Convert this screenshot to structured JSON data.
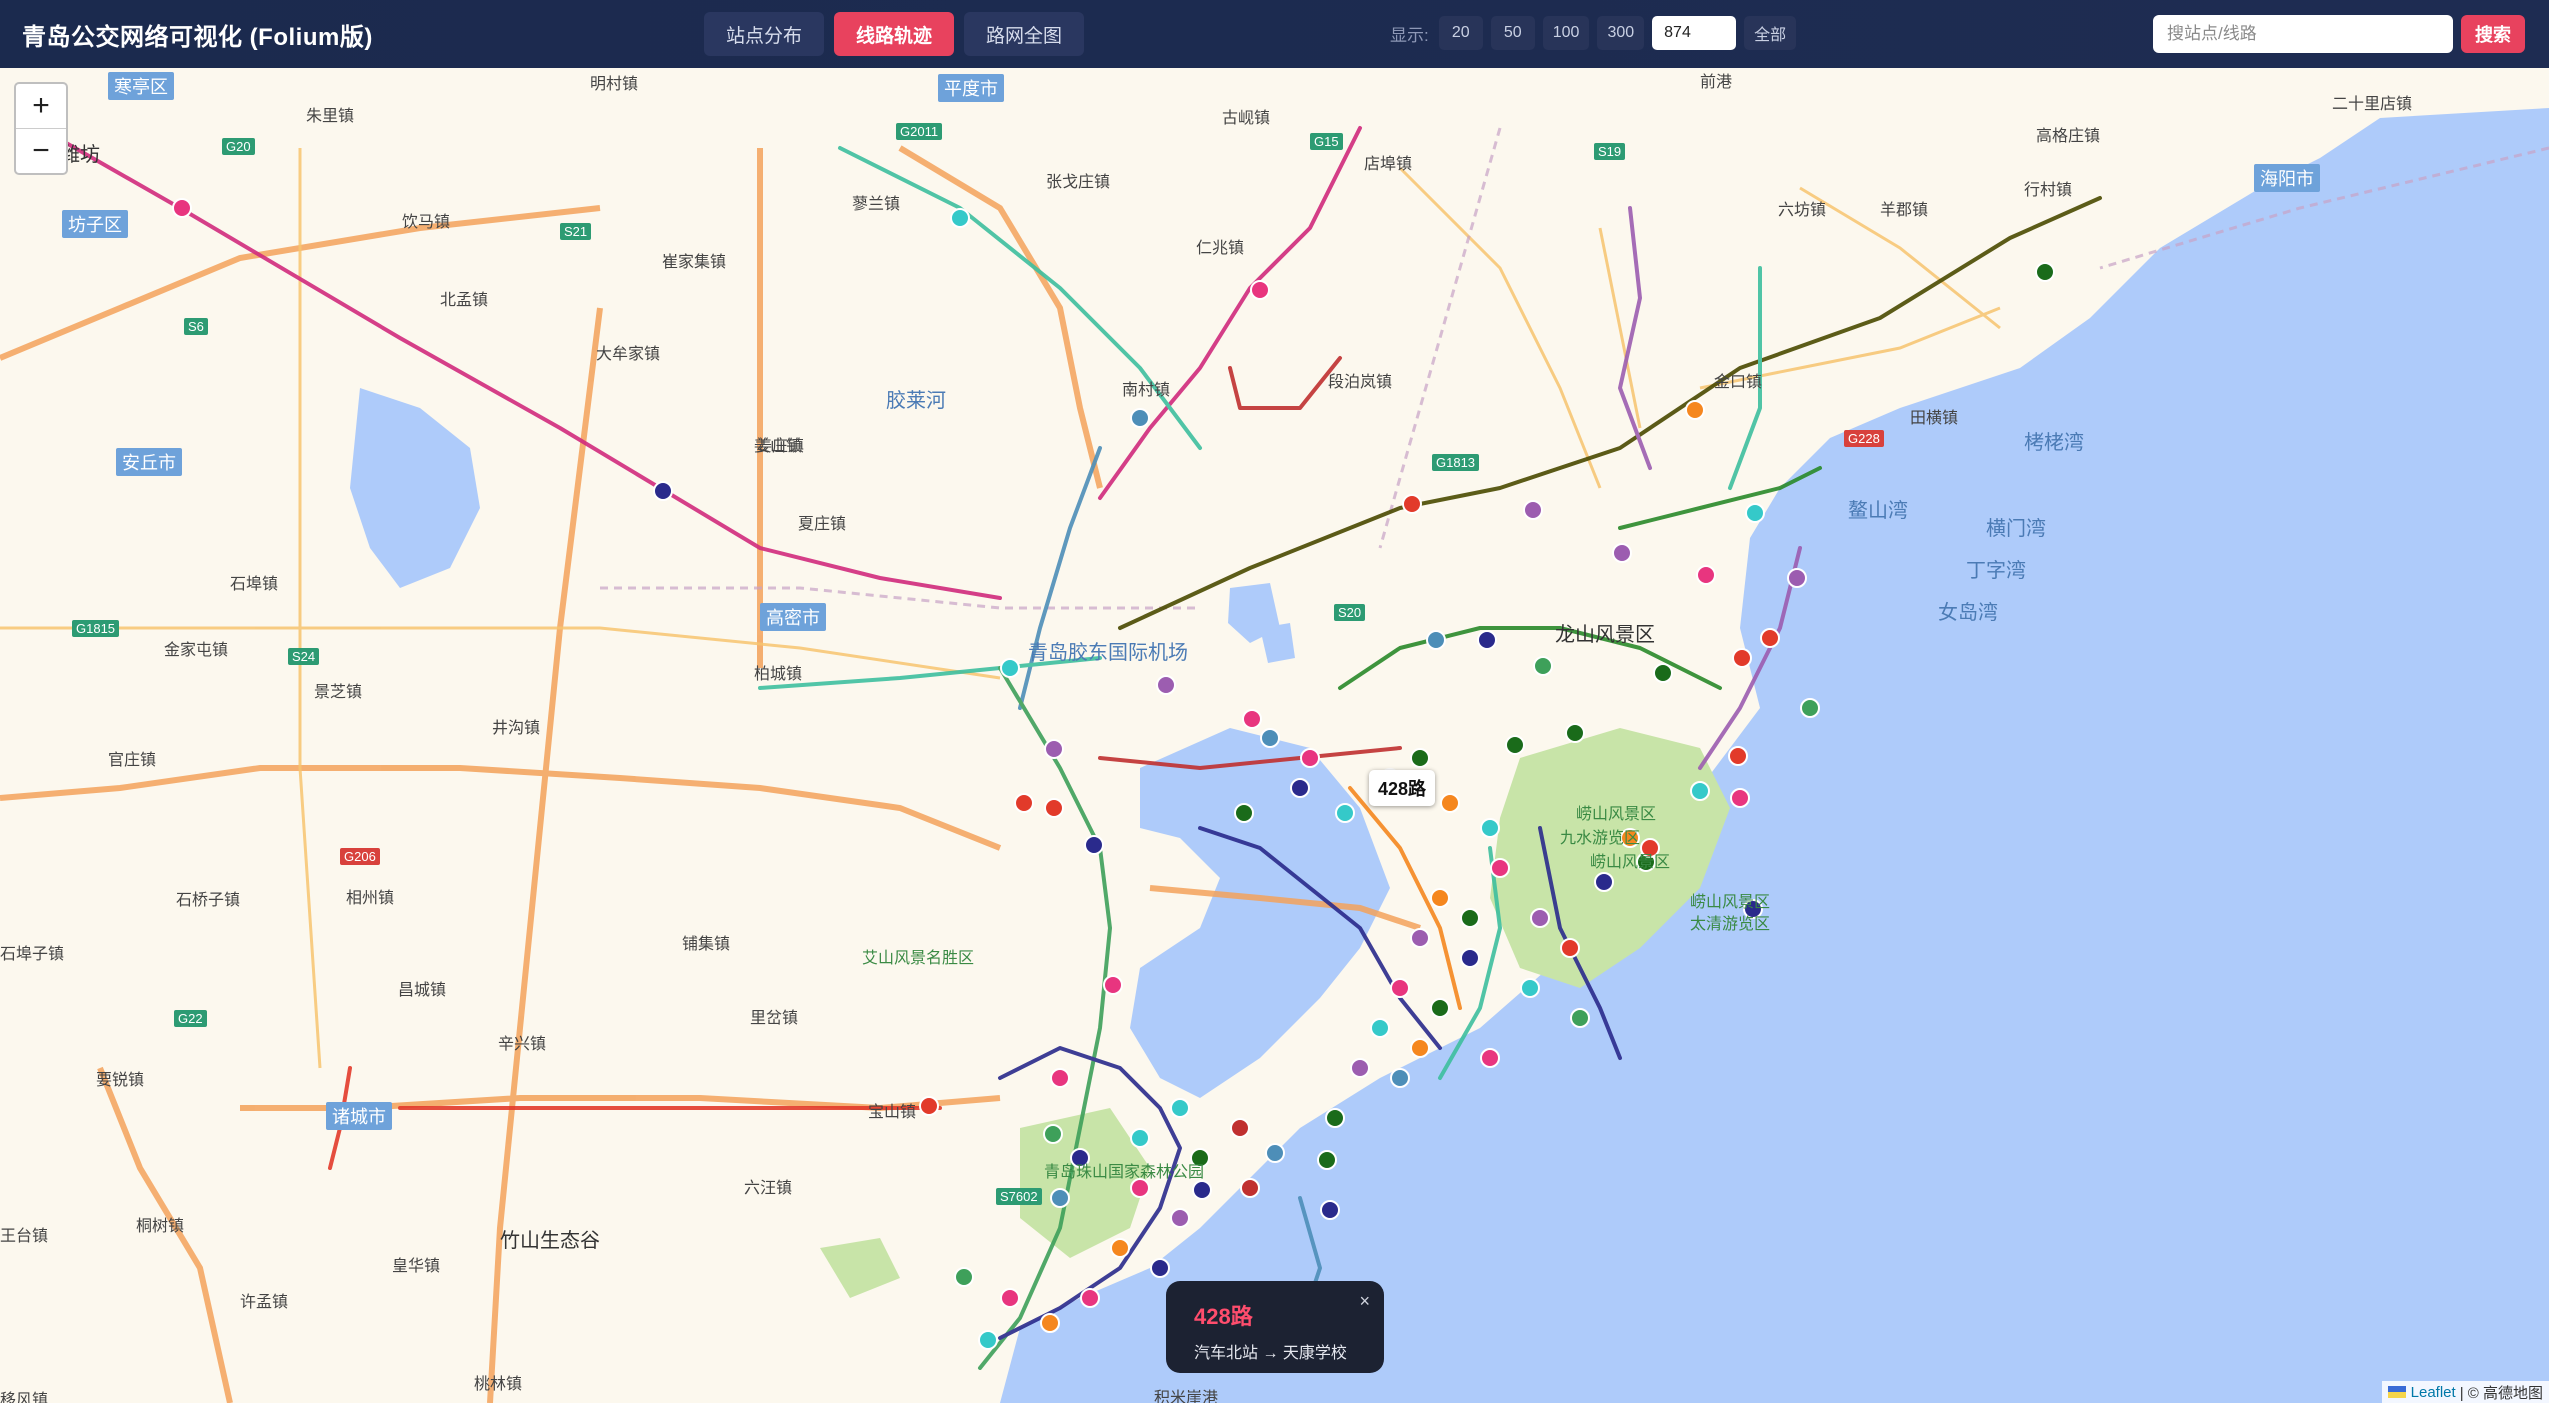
{
  "app": {
    "title": "青岛公交网络可视化 (Folium版)"
  },
  "modes": [
    {
      "label": "站点分布",
      "active": false
    },
    {
      "label": "线路轨迹",
      "active": true
    },
    {
      "label": "路网全图",
      "active": false
    }
  ],
  "display": {
    "label": "显示:",
    "options": [
      "20",
      "50",
      "100",
      "300"
    ],
    "custom_value": "874",
    "all_label": "全部"
  },
  "search": {
    "placeholder": "搜站点/线路",
    "button_label": "搜索"
  },
  "map": {
    "zoom_in": "+",
    "zoom_out": "−",
    "route_tag": "428路",
    "attribution_leaflet": "Leaflet",
    "attribution_rest": "| © 高德地图",
    "places": [
      {
        "text": "寒亭区",
        "type": "city"
      },
      {
        "text": "坊子区",
        "type": "city"
      },
      {
        "text": "安丘市",
        "type": "city"
      },
      {
        "text": "平度市",
        "type": "city"
      },
      {
        "text": "高密市",
        "type": "city"
      },
      {
        "text": "诸城市",
        "type": "city"
      },
      {
        "text": "海阳市",
        "type": "city"
      },
      {
        "text": "潍坊",
        "type": "big"
      },
      {
        "text": "胶莱河",
        "type": "blue"
      },
      {
        "text": "青岛胶东国际机场",
        "type": "blue"
      },
      {
        "text": "龙山风景区",
        "type": "big"
      },
      {
        "text": "崂山风景区",
        "type": "green"
      },
      {
        "text": "九水游览区",
        "type": "green"
      },
      {
        "text": "崂山风景区",
        "type": "green"
      },
      {
        "text": "崂山风景区",
        "type": "green"
      },
      {
        "text": "太清游览区",
        "type": "green"
      },
      {
        "text": "艾山风景名胜区",
        "type": "green"
      },
      {
        "text": "青岛珠山国家森林公园",
        "type": "green"
      },
      {
        "text": "竹山生态谷",
        "type": "big"
      },
      {
        "text": "鳌山湾",
        "type": "blue"
      },
      {
        "text": "横门湾",
        "type": "blue"
      },
      {
        "text": "丁字湾",
        "type": "blue"
      },
      {
        "text": "女岛湾",
        "type": "blue"
      },
      {
        "text": "栲栳湾",
        "type": "blue"
      },
      {
        "text": "朱里镇",
        "type": "town"
      },
      {
        "text": "明村镇",
        "type": "town"
      },
      {
        "text": "古岘镇",
        "type": "town"
      },
      {
        "text": "店埠镇",
        "type": "town"
      },
      {
        "text": "高格庄镇",
        "type": "town"
      },
      {
        "text": "二十里店镇",
        "type": "town"
      },
      {
        "text": "张戈庄镇",
        "type": "town"
      },
      {
        "text": "蓼兰镇",
        "type": "town"
      },
      {
        "text": "仁兆镇",
        "type": "town"
      },
      {
        "text": "姜山镇",
        "type": "town"
      },
      {
        "text": "六坊镇",
        "type": "town"
      },
      {
        "text": "羊郡镇",
        "type": "town"
      },
      {
        "text": "行村镇",
        "type": "town"
      },
      {
        "text": "饮马镇",
        "type": "town"
      },
      {
        "text": "崔家集镇",
        "type": "town"
      },
      {
        "text": "北孟镇",
        "type": "town"
      },
      {
        "text": "大牟家镇",
        "type": "town"
      },
      {
        "text": "南村镇",
        "type": "town"
      },
      {
        "text": "段泊岚镇",
        "type": "town"
      },
      {
        "text": "金口镇",
        "type": "town"
      },
      {
        "text": "田横镇",
        "type": "town"
      },
      {
        "text": "姜庄镇",
        "type": "town"
      },
      {
        "text": "夏庄镇",
        "type": "town"
      },
      {
        "text": "石埠镇",
        "type": "town"
      },
      {
        "text": "金家屯镇",
        "type": "town"
      },
      {
        "text": "景芝镇",
        "type": "town"
      },
      {
        "text": "柏城镇",
        "type": "town"
      },
      {
        "text": "井沟镇",
        "type": "town"
      },
      {
        "text": "官庄镇",
        "type": "town"
      },
      {
        "text": "石桥子镇",
        "type": "town"
      },
      {
        "text": "相州镇",
        "type": "town"
      },
      {
        "text": "铺集镇",
        "type": "town"
      },
      {
        "text": "石埠子镇",
        "type": "town"
      },
      {
        "text": "昌城镇",
        "type": "town"
      },
      {
        "text": "辛兴镇",
        "type": "town"
      },
      {
        "text": "里岔镇",
        "type": "town"
      },
      {
        "text": "宝山镇",
        "type": "town"
      },
      {
        "text": "六汪镇",
        "type": "town"
      },
      {
        "text": "要锐镇",
        "type": "town"
      },
      {
        "text": "桐树镇",
        "type": "town"
      },
      {
        "text": "皇华镇",
        "type": "town"
      },
      {
        "text": "许孟镇",
        "type": "town"
      },
      {
        "text": "桃林镇",
        "type": "town"
      },
      {
        "text": "王台镇",
        "type": "town"
      },
      {
        "text": "积米崖港",
        "type": "town"
      },
      {
        "text": "前港",
        "type": "town"
      },
      {
        "text": "移风镇",
        "type": "town"
      }
    ],
    "roads": [
      {
        "text": "G20",
        "type": "g"
      },
      {
        "text": "S21",
        "type": "g"
      },
      {
        "text": "S6",
        "type": "g"
      },
      {
        "text": "G2011",
        "type": "g"
      },
      {
        "text": "G15",
        "type": "g"
      },
      {
        "text": "S19",
        "type": "g"
      },
      {
        "text": "G1815",
        "type": "g"
      },
      {
        "text": "S24",
        "type": "g"
      },
      {
        "text": "G206",
        "type": "r"
      },
      {
        "text": "G22",
        "type": "g"
      },
      {
        "text": "S7602",
        "type": "g"
      },
      {
        "text": "G228",
        "type": "r"
      },
      {
        "text": "G1813",
        "type": "g"
      },
      {
        "text": "S20",
        "type": "g"
      }
    ]
  },
  "route_info": {
    "name": "428路",
    "path": "汽车北站 → 天康学校",
    "close": "×"
  },
  "colors": {
    "topbar": "#1b2a4e",
    "accent": "#e8425e",
    "sea": "#aecbfa",
    "land": "#fcf8ee",
    "park": "#c8e4a8"
  }
}
